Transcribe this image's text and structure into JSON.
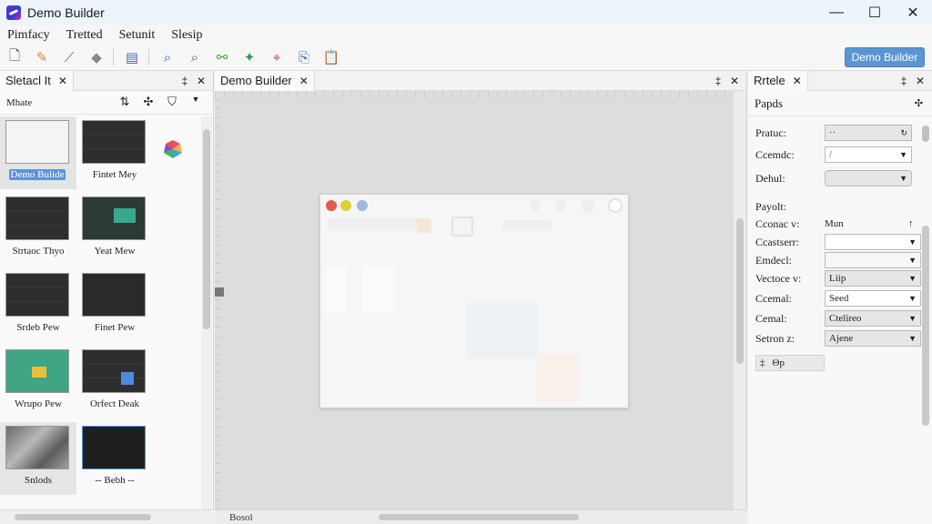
{
  "window": {
    "title": "Demo Builder",
    "minimize": "—",
    "maximize": "☐",
    "close": "✕"
  },
  "menu": [
    "Pimfacy",
    "Tretted",
    "Setunit",
    "Slesip"
  ],
  "toolbar": {
    "primary_label": "Demo Builder"
  },
  "left_panel": {
    "tab_label": "Sletacl It",
    "filter_placeholder": "Mhate",
    "thumbnails": [
      {
        "label": "Demo Bulide",
        "selected": true
      },
      {
        "label": "Fintet Mey"
      },
      {
        "label": "Strtaoc Thyo"
      },
      {
        "label": "Yeat Mew"
      },
      {
        "label": "Srdeb Pew"
      },
      {
        "label": "Finet Pew"
      },
      {
        "label": "Wrupo Pew"
      },
      {
        "label": "Orfect Deak"
      },
      {
        "label": "Snlods"
      },
      {
        "label": "-- Bebh --"
      }
    ]
  },
  "center_panel": {
    "tab_label": "Demo Builder",
    "status": "Bosol"
  },
  "right_panel": {
    "tab_label": "Rrtele",
    "section_title": "Papds",
    "props": [
      {
        "label": "Pratuc:",
        "value": "··"
      },
      {
        "label": "Ccemdc:",
        "value": "/"
      },
      {
        "label": "Dehul:",
        "value": ""
      }
    ],
    "section2_title": "Payolt:",
    "props2": [
      {
        "label": "Cconac v:",
        "value": "Mun"
      },
      {
        "label": "Ccastserr:",
        "value": ""
      },
      {
        "label": "Emdecl:",
        "value": ""
      },
      {
        "label": "Vectoce v:",
        "value": "Liip"
      },
      {
        "label": "Ccemal:",
        "value": "Seed"
      },
      {
        "label": "Cemal:",
        "value": "Ctelireo"
      },
      {
        "label": "Setron z:",
        "value": "Ajene"
      }
    ],
    "footer": "Θp"
  }
}
